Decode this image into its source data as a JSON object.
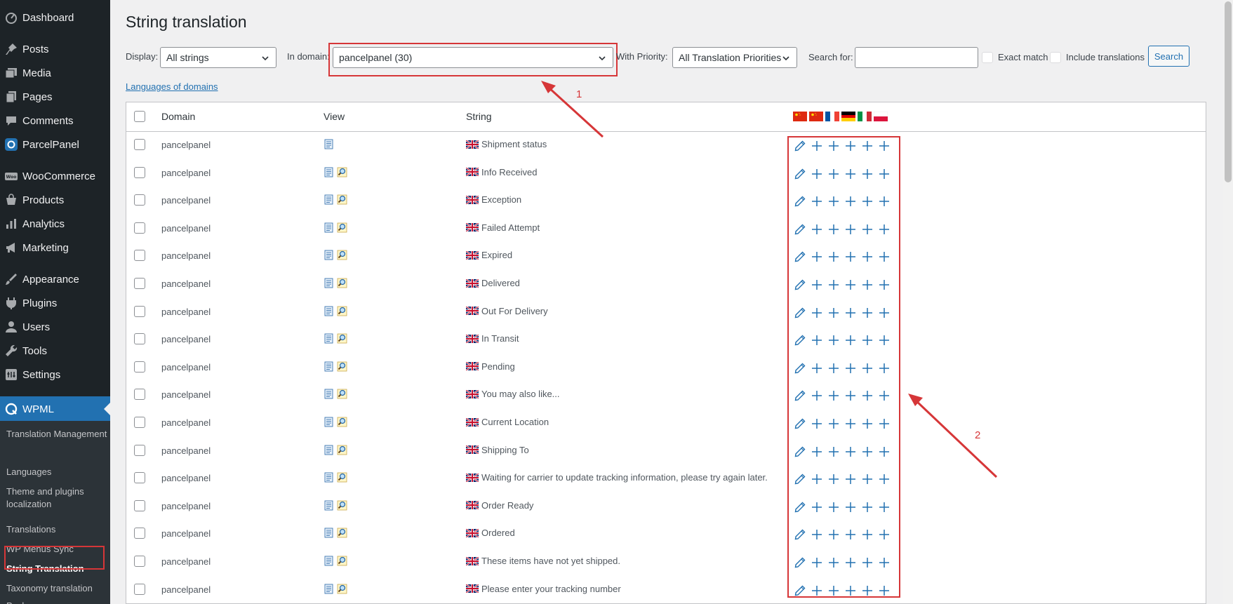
{
  "sidebar": {
    "items": [
      {
        "label": "Dashboard",
        "icon": "dashboard-icon"
      },
      {
        "label": "Posts",
        "icon": "pin-icon"
      },
      {
        "label": "Media",
        "icon": "media-icon"
      },
      {
        "label": "Pages",
        "icon": "pages-icon"
      },
      {
        "label": "Comments",
        "icon": "comment-icon"
      },
      {
        "label": "ParcelPanel",
        "icon": "parcelpanel-icon"
      },
      {
        "label": "WooCommerce",
        "icon": "woocommerce-icon"
      },
      {
        "label": "Products",
        "icon": "products-icon"
      },
      {
        "label": "Analytics",
        "icon": "analytics-icon"
      },
      {
        "label": "Marketing",
        "icon": "megaphone-icon"
      },
      {
        "label": "Appearance",
        "icon": "brush-icon"
      },
      {
        "label": "Plugins",
        "icon": "plug-icon"
      },
      {
        "label": "Users",
        "icon": "user-icon"
      },
      {
        "label": "Tools",
        "icon": "wrench-icon"
      },
      {
        "label": "Settings",
        "icon": "settings-icon"
      },
      {
        "label": "WPML",
        "icon": "wpml-icon"
      }
    ],
    "submenu": [
      {
        "label": "Translation Management"
      },
      {
        "label": "Languages"
      },
      {
        "label": "Theme and plugins localization"
      },
      {
        "label": "Translations"
      },
      {
        "label": "WP Menus Sync"
      },
      {
        "label": "String Translation"
      },
      {
        "label": "Taxonomy translation"
      },
      {
        "label": "Packages"
      }
    ]
  },
  "page": {
    "title": "String translation"
  },
  "filters": {
    "display_label": "Display:",
    "display_value": "All strings",
    "domain_label": "In domain:",
    "domain_value": "pancelpanel (30)",
    "priority_label": "With Priority:",
    "priority_value": "All Translation Priorities",
    "search_label": "Search for:",
    "search_value": "",
    "exact_match_label": "Exact match",
    "include_translations_label": "Include translations",
    "search_button": "Search"
  },
  "languages_link": "Languages of domains",
  "annotations": {
    "one": "1",
    "two": "2"
  },
  "table": {
    "headers": {
      "domain": "Domain",
      "view": "View",
      "string": "String"
    },
    "flags": [
      "china-flag-icon",
      "china-flag-icon",
      "france-flag-icon",
      "germany-flag-icon",
      "italy-flag-icon",
      "poland-flag-icon"
    ],
    "rows": [
      {
        "domain": "pancelpanel",
        "string": "Shipment status",
        "view_icons": [
          "document-icon"
        ]
      },
      {
        "domain": "pancelpanel",
        "string": "Info Received",
        "view_icons": [
          "document-icon",
          "magnifier-icon"
        ]
      },
      {
        "domain": "pancelpanel",
        "string": "Exception",
        "view_icons": [
          "document-icon",
          "magnifier-icon"
        ]
      },
      {
        "domain": "pancelpanel",
        "string": "Failed Attempt",
        "view_icons": [
          "document-icon",
          "magnifier-icon"
        ]
      },
      {
        "domain": "pancelpanel",
        "string": "Expired",
        "view_icons": [
          "document-icon",
          "magnifier-icon"
        ]
      },
      {
        "domain": "pancelpanel",
        "string": "Delivered",
        "view_icons": [
          "document-icon",
          "magnifier-icon"
        ]
      },
      {
        "domain": "pancelpanel",
        "string": "Out For Delivery",
        "view_icons": [
          "document-icon",
          "magnifier-icon"
        ]
      },
      {
        "domain": "pancelpanel",
        "string": "In Transit",
        "view_icons": [
          "document-icon",
          "magnifier-icon"
        ]
      },
      {
        "domain": "pancelpanel",
        "string": "Pending",
        "view_icons": [
          "document-icon",
          "magnifier-icon"
        ]
      },
      {
        "domain": "pancelpanel",
        "string": "You may also like...",
        "view_icons": [
          "document-icon",
          "magnifier-icon"
        ]
      },
      {
        "domain": "pancelpanel",
        "string": "Current Location",
        "view_icons": [
          "document-icon",
          "magnifier-icon"
        ]
      },
      {
        "domain": "pancelpanel",
        "string": "Shipping To",
        "view_icons": [
          "document-icon",
          "magnifier-icon"
        ]
      },
      {
        "domain": "pancelpanel",
        "string": "Waiting for carrier to update tracking information, please try again later.",
        "view_icons": [
          "document-icon",
          "magnifier-icon"
        ]
      },
      {
        "domain": "pancelpanel",
        "string": "Order Ready",
        "view_icons": [
          "document-icon",
          "magnifier-icon"
        ]
      },
      {
        "domain": "pancelpanel",
        "string": "Ordered",
        "view_icons": [
          "document-icon",
          "magnifier-icon"
        ]
      },
      {
        "domain": "pancelpanel",
        "string": "These items have not yet shipped.",
        "view_icons": [
          "document-icon",
          "magnifier-icon"
        ]
      },
      {
        "domain": "pancelpanel",
        "string": "Please enter your tracking number",
        "view_icons": [
          "document-icon",
          "magnifier-icon"
        ]
      }
    ]
  }
}
